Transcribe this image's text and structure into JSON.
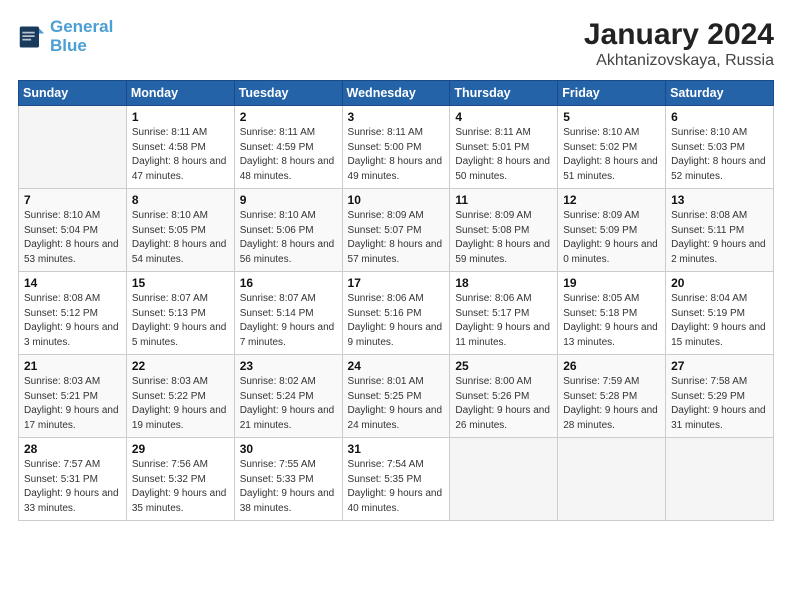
{
  "header": {
    "logo_line1": "General",
    "logo_line2": "Blue",
    "month": "January 2024",
    "location": "Akhtanizovskaya, Russia"
  },
  "weekdays": [
    "Sunday",
    "Monday",
    "Tuesday",
    "Wednesday",
    "Thursday",
    "Friday",
    "Saturday"
  ],
  "weeks": [
    [
      {
        "day": "",
        "info": ""
      },
      {
        "day": "1",
        "info": "Sunrise: 8:11 AM\nSunset: 4:58 PM\nDaylight: 8 hours\nand 47 minutes."
      },
      {
        "day": "2",
        "info": "Sunrise: 8:11 AM\nSunset: 4:59 PM\nDaylight: 8 hours\nand 48 minutes."
      },
      {
        "day": "3",
        "info": "Sunrise: 8:11 AM\nSunset: 5:00 PM\nDaylight: 8 hours\nand 49 minutes."
      },
      {
        "day": "4",
        "info": "Sunrise: 8:11 AM\nSunset: 5:01 PM\nDaylight: 8 hours\nand 50 minutes."
      },
      {
        "day": "5",
        "info": "Sunrise: 8:10 AM\nSunset: 5:02 PM\nDaylight: 8 hours\nand 51 minutes."
      },
      {
        "day": "6",
        "info": "Sunrise: 8:10 AM\nSunset: 5:03 PM\nDaylight: 8 hours\nand 52 minutes."
      }
    ],
    [
      {
        "day": "7",
        "info": "Sunrise: 8:10 AM\nSunset: 5:04 PM\nDaylight: 8 hours\nand 53 minutes."
      },
      {
        "day": "8",
        "info": "Sunrise: 8:10 AM\nSunset: 5:05 PM\nDaylight: 8 hours\nand 54 minutes."
      },
      {
        "day": "9",
        "info": "Sunrise: 8:10 AM\nSunset: 5:06 PM\nDaylight: 8 hours\nand 56 minutes."
      },
      {
        "day": "10",
        "info": "Sunrise: 8:09 AM\nSunset: 5:07 PM\nDaylight: 8 hours\nand 57 minutes."
      },
      {
        "day": "11",
        "info": "Sunrise: 8:09 AM\nSunset: 5:08 PM\nDaylight: 8 hours\nand 59 minutes."
      },
      {
        "day": "12",
        "info": "Sunrise: 8:09 AM\nSunset: 5:09 PM\nDaylight: 9 hours\nand 0 minutes."
      },
      {
        "day": "13",
        "info": "Sunrise: 8:08 AM\nSunset: 5:11 PM\nDaylight: 9 hours\nand 2 minutes."
      }
    ],
    [
      {
        "day": "14",
        "info": "Sunrise: 8:08 AM\nSunset: 5:12 PM\nDaylight: 9 hours\nand 3 minutes."
      },
      {
        "day": "15",
        "info": "Sunrise: 8:07 AM\nSunset: 5:13 PM\nDaylight: 9 hours\nand 5 minutes."
      },
      {
        "day": "16",
        "info": "Sunrise: 8:07 AM\nSunset: 5:14 PM\nDaylight: 9 hours\nand 7 minutes."
      },
      {
        "day": "17",
        "info": "Sunrise: 8:06 AM\nSunset: 5:16 PM\nDaylight: 9 hours\nand 9 minutes."
      },
      {
        "day": "18",
        "info": "Sunrise: 8:06 AM\nSunset: 5:17 PM\nDaylight: 9 hours\nand 11 minutes."
      },
      {
        "day": "19",
        "info": "Sunrise: 8:05 AM\nSunset: 5:18 PM\nDaylight: 9 hours\nand 13 minutes."
      },
      {
        "day": "20",
        "info": "Sunrise: 8:04 AM\nSunset: 5:19 PM\nDaylight: 9 hours\nand 15 minutes."
      }
    ],
    [
      {
        "day": "21",
        "info": "Sunrise: 8:03 AM\nSunset: 5:21 PM\nDaylight: 9 hours\nand 17 minutes."
      },
      {
        "day": "22",
        "info": "Sunrise: 8:03 AM\nSunset: 5:22 PM\nDaylight: 9 hours\nand 19 minutes."
      },
      {
        "day": "23",
        "info": "Sunrise: 8:02 AM\nSunset: 5:24 PM\nDaylight: 9 hours\nand 21 minutes."
      },
      {
        "day": "24",
        "info": "Sunrise: 8:01 AM\nSunset: 5:25 PM\nDaylight: 9 hours\nand 24 minutes."
      },
      {
        "day": "25",
        "info": "Sunrise: 8:00 AM\nSunset: 5:26 PM\nDaylight: 9 hours\nand 26 minutes."
      },
      {
        "day": "26",
        "info": "Sunrise: 7:59 AM\nSunset: 5:28 PM\nDaylight: 9 hours\nand 28 minutes."
      },
      {
        "day": "27",
        "info": "Sunrise: 7:58 AM\nSunset: 5:29 PM\nDaylight: 9 hours\nand 31 minutes."
      }
    ],
    [
      {
        "day": "28",
        "info": "Sunrise: 7:57 AM\nSunset: 5:31 PM\nDaylight: 9 hours\nand 33 minutes."
      },
      {
        "day": "29",
        "info": "Sunrise: 7:56 AM\nSunset: 5:32 PM\nDaylight: 9 hours\nand 35 minutes."
      },
      {
        "day": "30",
        "info": "Sunrise: 7:55 AM\nSunset: 5:33 PM\nDaylight: 9 hours\nand 38 minutes."
      },
      {
        "day": "31",
        "info": "Sunrise: 7:54 AM\nSunset: 5:35 PM\nDaylight: 9 hours\nand 40 minutes."
      },
      {
        "day": "",
        "info": ""
      },
      {
        "day": "",
        "info": ""
      },
      {
        "day": "",
        "info": ""
      }
    ]
  ]
}
